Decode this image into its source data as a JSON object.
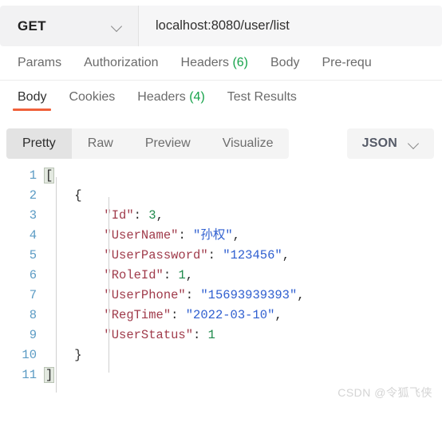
{
  "request_bar": {
    "method": "GET",
    "method_chevron_icon": "chevron-down-icon",
    "url": "localhost:8080/user/list"
  },
  "request_tabs": [
    {
      "label": "Params",
      "count": "",
      "active": false
    },
    {
      "label": "Authorization",
      "count": "",
      "active": false
    },
    {
      "label": "Headers",
      "count": "(6)",
      "active": false
    },
    {
      "label": "Body",
      "count": "",
      "active": false
    },
    {
      "label": "Pre-requ",
      "count": "",
      "active": false
    }
  ],
  "response_tabs": [
    {
      "label": "Body",
      "count": "",
      "active": true
    },
    {
      "label": "Cookies",
      "count": "",
      "active": false
    },
    {
      "label": "Headers",
      "count": "(4)",
      "active": false
    },
    {
      "label": "Test Results",
      "count": "",
      "active": false
    }
  ],
  "view_modes": [
    {
      "label": "Pretty",
      "active": true
    },
    {
      "label": "Raw",
      "active": false
    },
    {
      "label": "Preview",
      "active": false
    },
    {
      "label": "Visualize",
      "active": false
    }
  ],
  "format_select": {
    "label": "JSON",
    "chevron_icon": "chevron-down-icon"
  },
  "response_body": {
    "language": "json",
    "lines": [
      {
        "num": "1",
        "indent": 0,
        "tokens": [
          {
            "t": "[",
            "c": "p brk"
          }
        ]
      },
      {
        "num": "2",
        "indent": 1,
        "tokens": [
          {
            "t": "{",
            "c": "p"
          }
        ]
      },
      {
        "num": "3",
        "indent": 2,
        "tokens": [
          {
            "t": "\"Id\"",
            "c": "k"
          },
          {
            "t": ": ",
            "c": "p"
          },
          {
            "t": "3",
            "c": "n"
          },
          {
            "t": ",",
            "c": "p"
          }
        ]
      },
      {
        "num": "4",
        "indent": 2,
        "tokens": [
          {
            "t": "\"UserName\"",
            "c": "k"
          },
          {
            "t": ": ",
            "c": "p"
          },
          {
            "t": "\"孙权\"",
            "c": "s"
          },
          {
            "t": ",",
            "c": "p"
          }
        ]
      },
      {
        "num": "5",
        "indent": 2,
        "tokens": [
          {
            "t": "\"UserPassword\"",
            "c": "k"
          },
          {
            "t": ": ",
            "c": "p"
          },
          {
            "t": "\"123456\"",
            "c": "s"
          },
          {
            "t": ",",
            "c": "p"
          }
        ]
      },
      {
        "num": "6",
        "indent": 2,
        "tokens": [
          {
            "t": "\"RoleId\"",
            "c": "k"
          },
          {
            "t": ": ",
            "c": "p"
          },
          {
            "t": "1",
            "c": "n"
          },
          {
            "t": ",",
            "c": "p"
          }
        ]
      },
      {
        "num": "7",
        "indent": 2,
        "tokens": [
          {
            "t": "\"UserPhone\"",
            "c": "k"
          },
          {
            "t": ": ",
            "c": "p"
          },
          {
            "t": "\"15693939393\"",
            "c": "s"
          },
          {
            "t": ",",
            "c": "p"
          }
        ]
      },
      {
        "num": "8",
        "indent": 2,
        "tokens": [
          {
            "t": "\"RegTime\"",
            "c": "k"
          },
          {
            "t": ": ",
            "c": "p"
          },
          {
            "t": "\"2022-03-10\"",
            "c": "s"
          },
          {
            "t": ",",
            "c": "p"
          }
        ]
      },
      {
        "num": "9",
        "indent": 2,
        "tokens": [
          {
            "t": "\"UserStatus\"",
            "c": "k"
          },
          {
            "t": ": ",
            "c": "p"
          },
          {
            "t": "1",
            "c": "n"
          }
        ]
      },
      {
        "num": "10",
        "indent": 1,
        "tokens": [
          {
            "t": "}",
            "c": "p"
          }
        ]
      },
      {
        "num": "11",
        "indent": 0,
        "tokens": [
          {
            "t": "]",
            "c": "p brk"
          }
        ]
      }
    ],
    "parsed": [
      {
        "Id": 3,
        "UserName": "孙权",
        "UserPassword": "123456",
        "RoleId": 1,
        "UserPhone": "15693939393",
        "RegTime": "2022-03-10",
        "UserStatus": 1
      }
    ]
  },
  "watermark": "CSDN @令狐飞侠",
  "colors": {
    "accent_orange": "#f0603a",
    "count_green": "#16a34a",
    "json_key": "#a03b4b",
    "json_string": "#2f5fd0",
    "json_number": "#1f8a4c",
    "line_number": "#5b9bc4",
    "chrome_gray": "#f2f2f3"
  }
}
